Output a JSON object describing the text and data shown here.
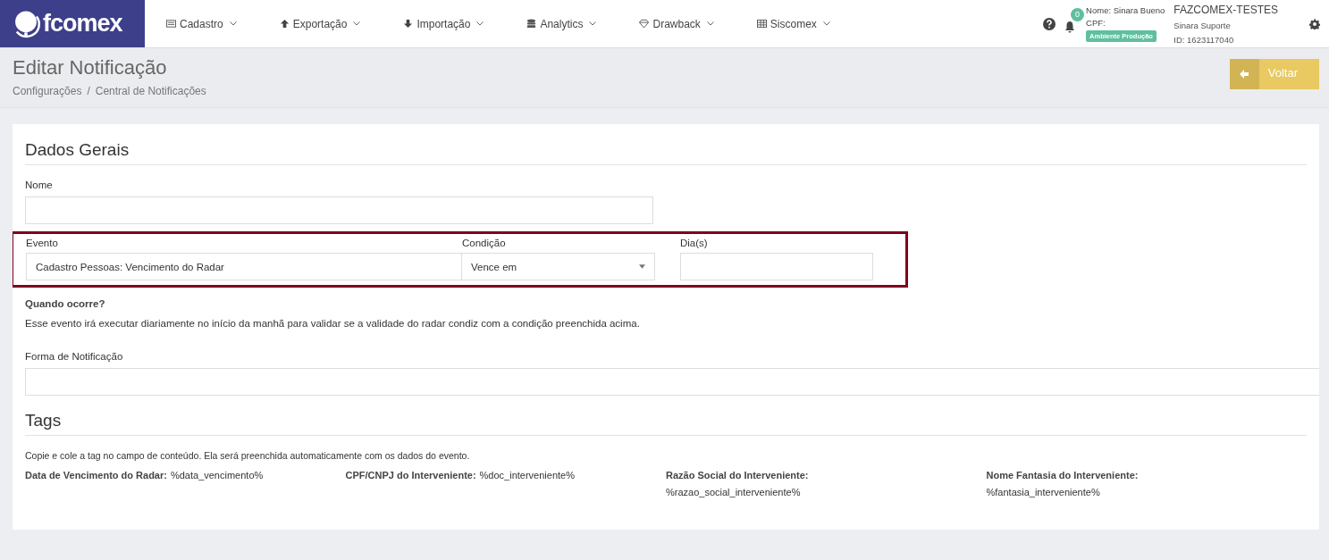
{
  "brand": {
    "name": "fcomex"
  },
  "nav": [
    {
      "label": "Cadastro",
      "kind": "list"
    },
    {
      "label": "Exportação",
      "kind": "up"
    },
    {
      "label": "Importação",
      "kind": "down"
    },
    {
      "label": "Analytics",
      "kind": "db"
    },
    {
      "label": "Drawback",
      "kind": "diamond"
    },
    {
      "label": "Siscomex",
      "kind": "table"
    }
  ],
  "user": {
    "notifications": "0",
    "name_label": "Nome:",
    "name": "Sinara Bueno",
    "cpf_label": "CPF:",
    "environment": "Ambiente Produção",
    "company": "FAZCOMEX-TESTES",
    "role": "Sinara Suporte",
    "id": "ID: 1623117040"
  },
  "page": {
    "title": "Editar Notificação",
    "breadcrumb": [
      "Configurações",
      "/",
      "Central de Notificações"
    ],
    "back_button": "Voltar"
  },
  "general": {
    "heading": "Dados Gerais",
    "name_label": "Nome",
    "event_row": {
      "highlighted": true,
      "event_label": "Evento",
      "event_value": "Cadastro Pessoas: Vencimento do Radar",
      "condition_label": "Condição",
      "condition_value": "Vence em",
      "days_label": "Dia(s)"
    },
    "when_label": "Quando ocorre?",
    "when_text": "Esse evento irá executar diariamente no início da manhã para validar se a validade do radar condiz com a condição preenchida acima.",
    "notification_label": "Forma de Notificação"
  },
  "tags": {
    "heading": "Tags",
    "hint": "Copie e cole a tag no campo de conteúdo. Ela será preenchida automaticamente com os dados do evento.",
    "items": [
      {
        "kind": "inline",
        "label": "Data de Vencimento do Radar:",
        "value": "%data_vencimento%"
      },
      {
        "kind": "inline",
        "label": "CPF/CNPJ do Interveniente:",
        "value": "%doc_interveniente%"
      },
      {
        "kind": "stacked",
        "label": "Razão Social do Interveniente:",
        "value": "%razao_social_interveniente%"
      },
      {
        "kind": "stacked",
        "label": "Nome Fantasia do Interveniente:",
        "value": "%fantasia_interveniente%"
      }
    ]
  }
}
